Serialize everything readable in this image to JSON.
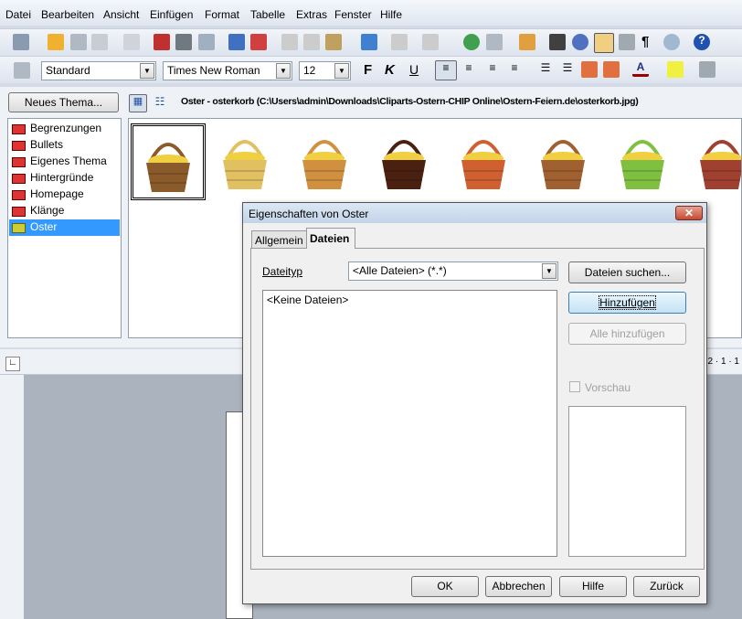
{
  "menu": [
    "Datei",
    "Bearbeiten",
    "Ansicht",
    "Einfügen",
    "Format",
    "Tabelle",
    "Extras",
    "Fenster",
    "Hilfe"
  ],
  "format": {
    "style": "Standard",
    "font": "Times New Roman",
    "size": "12",
    "bold": "F",
    "italic": "K",
    "underline": "U"
  },
  "gallery": {
    "new_theme": "Neues Thema...",
    "path": "Oster - osterkorb (C:\\Users\\admin\\Downloads\\Cliparts-Ostern-CHIP Online\\Ostern-Feiern.de\\osterkorb.jpg)",
    "themes": [
      "Begrenzungen",
      "Bullets",
      "Eigenes Thema",
      "Hintergründe",
      "Homepage",
      "Klänge",
      "Oster"
    ],
    "selected": "Oster"
  },
  "ruler": {
    "right_label": "12 · 1 · 1"
  },
  "dialog": {
    "title": "Eigenschaften von Oster",
    "tabs": [
      "Allgemein",
      "Dateien"
    ],
    "active_tab": "Dateien",
    "filetype_label": "Dateityp",
    "filetype_value": "<Alle Dateien> (*.*)",
    "files_empty": "<Keine Dateien>",
    "search": "Dateien suchen...",
    "add": "Hinzufügen",
    "add_all": "Alle hinzufügen",
    "preview": "Vorschau",
    "ok": "OK",
    "cancel": "Abbrechen",
    "help": "Hilfe",
    "back": "Zurück"
  },
  "colors": {
    "selection": "#3399ff",
    "title_bar": "#c3d4e8",
    "close": "#c44a30"
  }
}
